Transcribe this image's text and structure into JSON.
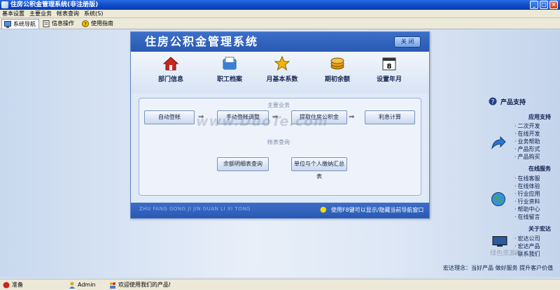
{
  "window": {
    "title": "住房公积金管理系统(非注册版)"
  },
  "menu": [
    "基本设置",
    "主要业务",
    "帐表查询",
    "系统(S)"
  ],
  "tabs": [
    {
      "label": "系统导航",
      "icon": "monitor-icon"
    },
    {
      "label": "信息操作",
      "icon": "document-icon"
    },
    {
      "label": "使用指南",
      "icon": "help-icon"
    }
  ],
  "panel": {
    "title": "住房公积金管理系统",
    "close_label": "关 闭",
    "nav": [
      {
        "label": "部门信息",
        "icon": "house-icon",
        "color": "#c8281e"
      },
      {
        "label": "职工档案",
        "icon": "folder-icon",
        "color": "#3a7fd1"
      },
      {
        "label": "月基本系数",
        "icon": "star-icon",
        "color": "#f2b705"
      },
      {
        "label": "期初余额",
        "icon": "coin-icon",
        "color": "#e8a317"
      },
      {
        "label": "设置年月",
        "icon": "calendar-icon",
        "color": "#333333"
      }
    ],
    "calendar_day": "8",
    "main_section": "主要业务",
    "flow": [
      "自动登帐",
      "手动登帐调整",
      "提取住房公积金",
      "利息计算"
    ],
    "report_section": "帐表查询",
    "reports": [
      "余额明细表查询",
      "单位与个人缴纳汇总表"
    ],
    "footer_pinyin": "ZHU FANG GONG JI JIN GUAN LI XI TONG",
    "footer_hint": "使用F8键可以显示/隐藏当前导航窗口"
  },
  "sidebar": {
    "heading": "产品支持",
    "groups": [
      {
        "title": "应用支持",
        "icon": "arrow-icon",
        "links": [
          "二次开发",
          "在线开发",
          "业务帮助",
          "产品形式",
          "产品购买"
        ]
      },
      {
        "title": "在线服务",
        "icon": "globe-icon",
        "links": [
          "在线客服",
          "在线体验",
          "行业应用",
          "行业资料",
          "帮助中心",
          "在线留言"
        ]
      },
      {
        "title": "关于宏达",
        "icon": "computer-icon",
        "links": [
          "宏达公司",
          "宏达产品",
          "联系我们"
        ]
      }
    ],
    "slogan": "宏达理念：当好产品 做好服务 提升客户价值"
  },
  "status": {
    "ready": "准备",
    "user": "Admin",
    "welcome": "欢迎使用我们的产品!"
  },
  "watermark": "www.DuoTe.com",
  "watermark2": "绿色资源网"
}
